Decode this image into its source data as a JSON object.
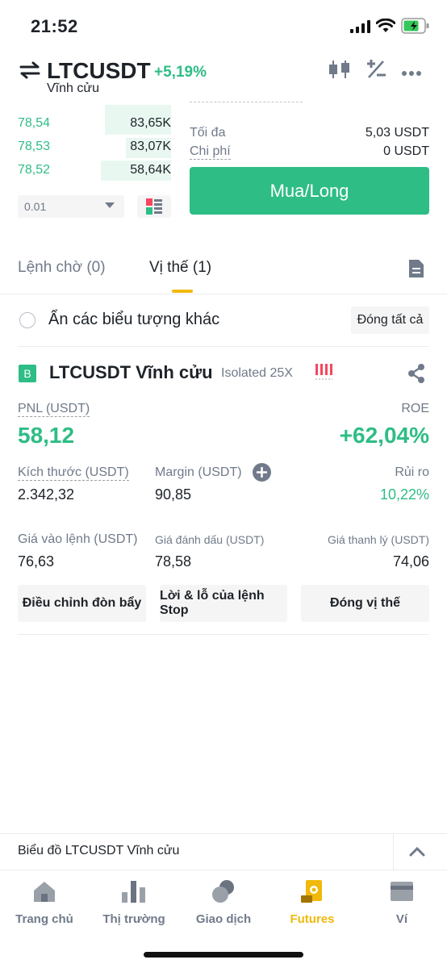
{
  "status_bar": {
    "time": "21:52"
  },
  "header": {
    "pair": "LTCUSDT",
    "change": "+5,19%",
    "subtitle": "Vĩnh cửu"
  },
  "order_book": {
    "rows": [
      {
        "price": "78,54",
        "qty": "83,65K"
      },
      {
        "price": "78,53",
        "qty": "83,07K"
      },
      {
        "price": "78,52",
        "qty": "58,64K"
      }
    ],
    "tick_size": "0.01"
  },
  "order_form": {
    "max_label": "Tối đa",
    "max_value": "5,03 USDT",
    "cost_label": "Chi phí",
    "cost_value": "0 USDT",
    "buy_label": "Mua/Long"
  },
  "tabs": [
    {
      "label": "Lệnh chờ (0)"
    },
    {
      "label": "Vị thế (1)"
    }
  ],
  "hide_symbols_label": "Ẩn các biểu tượng khác",
  "close_all_label": "Đóng tất cả",
  "position": {
    "side_badge": "B",
    "symbol": "LTCUSDT Vĩnh cửu",
    "margin_mode": "Isolated 25X",
    "pnl_label": "PNL (USDT)",
    "pnl_value": "58,12",
    "roe_label": "ROE",
    "roe_value": "+62,04%",
    "size_label": "Kích thước (USDT)",
    "size_value": "2.342,32",
    "margin_label": "Margin (USDT)",
    "margin_value": "90,85",
    "risk_label": "Rủi ro",
    "risk_value": "10,22%",
    "entry_label": "Giá vào lệnh (USDT)",
    "entry_value": "76,63",
    "mark_label": "Giá đánh dấu (USDT)",
    "mark_value": "78,58",
    "liq_label": "Giá thanh lý (USDT)",
    "liq_value": "74,06",
    "actions": [
      {
        "label": "Điều chỉnh đòn bẩy"
      },
      {
        "label": "Lời & lỗ của lệnh Stop"
      },
      {
        "label": "Đóng vị thế"
      }
    ]
  },
  "chart_bar_label": "Biểu đồ LTCUSDT Vĩnh cửu",
  "bottom_nav": [
    {
      "label": "Trang chủ",
      "icon": "home-icon"
    },
    {
      "label": "Thị trường",
      "icon": "markets-icon"
    },
    {
      "label": "Giao dịch",
      "icon": "trade-icon"
    },
    {
      "label": "Futures",
      "icon": "futures-icon",
      "active": true
    },
    {
      "label": "Ví",
      "icon": "wallet-icon"
    }
  ],
  "colors": {
    "green": "#2ebd85",
    "red": "#f6465d",
    "accent": "#f0b90b",
    "muted": "#707a8a"
  }
}
